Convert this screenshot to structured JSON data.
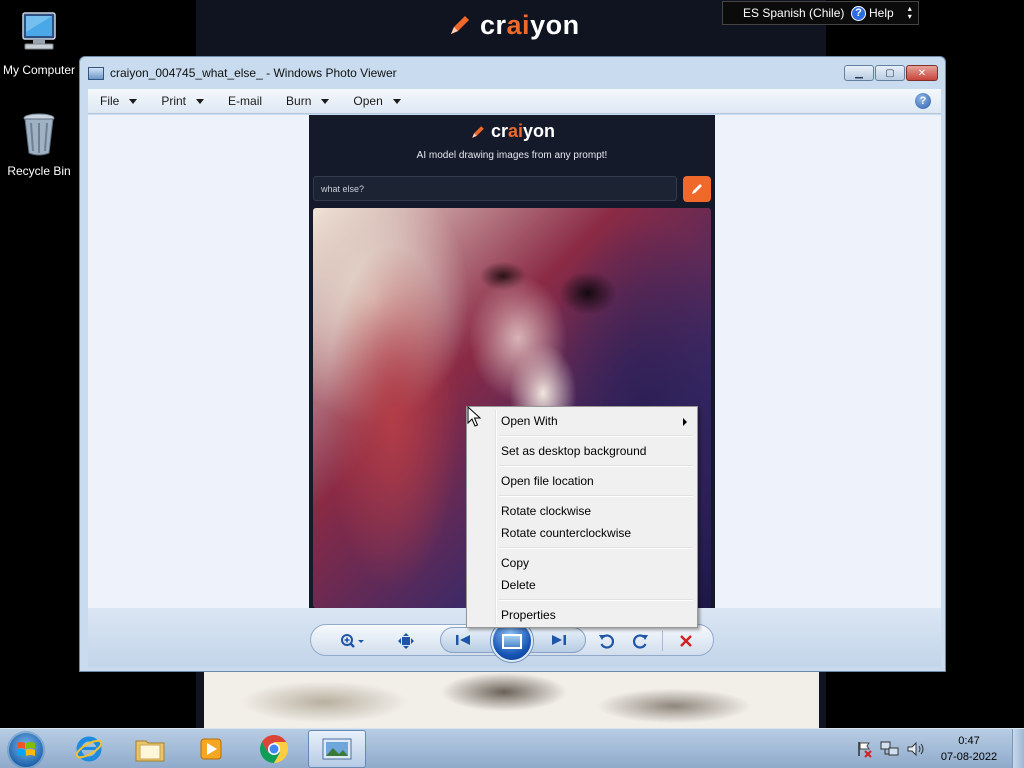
{
  "desktop": {
    "icons": [
      {
        "label": "My Computer",
        "icon": "computer-icon"
      },
      {
        "label": "Recycle Bin",
        "icon": "recycle-bin-icon"
      }
    ]
  },
  "background_page": {
    "brand": {
      "prefix": "cr",
      "highlight": "ai",
      "suffix": "yon"
    },
    "language_bar": {
      "language": "ES Spanish (Chile)",
      "help": "Help"
    }
  },
  "window": {
    "title": "craiyon_004745_what_else_ - Windows Photo Viewer",
    "controls": [
      "minimize",
      "maximize",
      "close"
    ],
    "menu": [
      {
        "label": "File",
        "has_dropdown": true
      },
      {
        "label": "Print",
        "has_dropdown": true
      },
      {
        "label": "E-mail",
        "has_dropdown": false
      },
      {
        "label": "Burn",
        "has_dropdown": true
      },
      {
        "label": "Open",
        "has_dropdown": true
      }
    ],
    "help_icon": "?"
  },
  "shown_image": {
    "brand": {
      "prefix": "cr",
      "highlight": "ai",
      "suffix": "yon"
    },
    "tagline": "AI model drawing images from any prompt!",
    "prompt_value": "what else?"
  },
  "controls": [
    "zoom-icon",
    "actual-size-icon",
    "previous-icon",
    "slideshow-icon",
    "next-icon",
    "rotate-counterclockwise-icon",
    "rotate-clockwise-icon",
    "delete-icon"
  ],
  "context_menu": {
    "groups": [
      [
        {
          "label": "Open With",
          "submenu": true
        }
      ],
      [
        {
          "label": "Set as desktop background"
        }
      ],
      [
        {
          "label": "Open file location"
        }
      ],
      [
        {
          "label": "Rotate clockwise"
        },
        {
          "label": "Rotate counterclockwise"
        }
      ],
      [
        {
          "label": "Copy"
        },
        {
          "label": "Delete"
        }
      ],
      [
        {
          "label": "Properties"
        }
      ]
    ]
  },
  "taskbar": {
    "apps": [
      "internet-explorer-icon",
      "file-explorer-icon",
      "media-player-icon",
      "chrome-icon",
      "photo-viewer-icon"
    ],
    "active_app": "photo-viewer-icon",
    "clock": {
      "time": "0:47",
      "date": "07-08-2022"
    }
  },
  "colors": {
    "accent_orange": "#f0682a",
    "window_frame": "#c9dcef",
    "taskbar": "#a8c0dc"
  }
}
